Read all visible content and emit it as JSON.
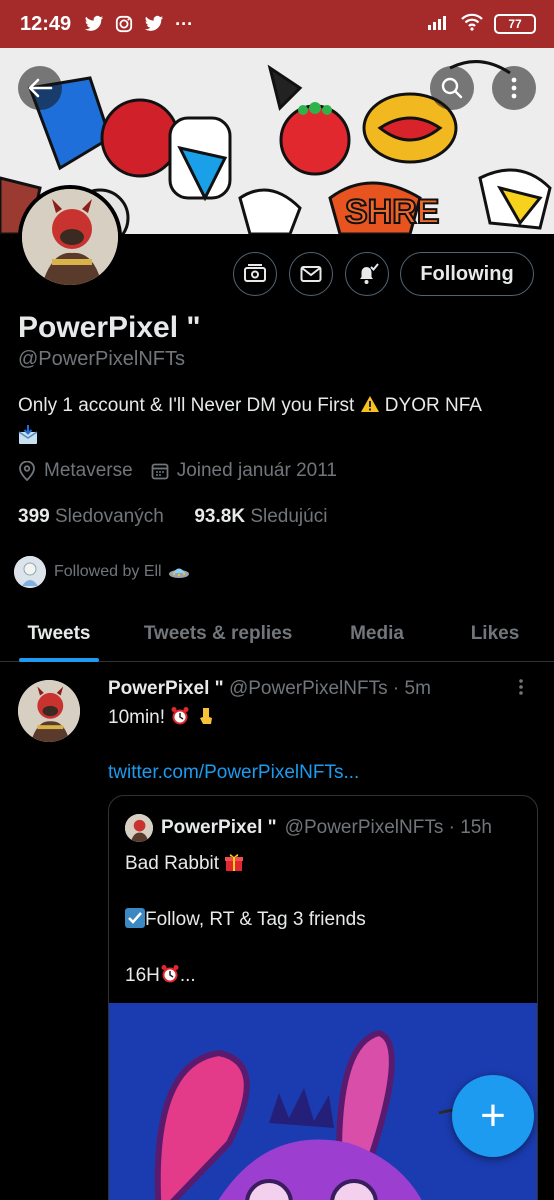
{
  "status_bar": {
    "time": "12:49",
    "battery": "77"
  },
  "profile": {
    "name": "PowerPixel \"",
    "handle": "@PowerPixelNFTs",
    "bio_text": "Only 1 account & I'll Never DM you First",
    "bio_tail": "DYOR NFA",
    "location": "Metaverse",
    "joined": "Joined január 2011",
    "following_count": "399",
    "following_label": "Sledovaných",
    "followers_count": "93.8K",
    "followers_label": "Sledujúci",
    "followed_by": "Followed by Ell",
    "follow_button": "Following"
  },
  "tabs": [
    {
      "label": "Tweets",
      "active": true
    },
    {
      "label": "Tweets & replies",
      "active": false
    },
    {
      "label": "Media",
      "active": false
    },
    {
      "label": "Likes",
      "active": false
    }
  ],
  "tweet": {
    "author_name": "PowerPixel \"",
    "author_handle": "@PowerPixelNFTs",
    "time": "· 5m",
    "text": "10min!",
    "link": "twitter.com/PowerPixelNFTs...",
    "quote": {
      "author_name": "PowerPixel \"",
      "author_handle": "@PowerPixelNFTs",
      "time": "· 15h",
      "line1": "Bad Rabbit",
      "line2": "Follow, RT & Tag 3 friends",
      "line3": "16H",
      "line3_tail": "..."
    }
  },
  "fab_label": "+",
  "colors": {
    "accent": "#1d9bf0",
    "status_bar": "#a52a2a",
    "background": "#000000"
  }
}
